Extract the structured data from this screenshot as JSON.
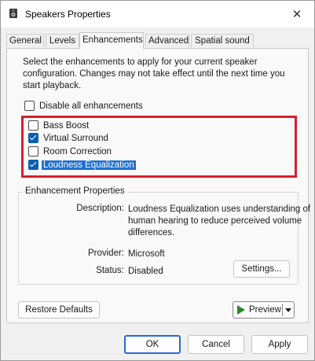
{
  "window": {
    "title": "Speakers Properties",
    "close_glyph": "✕"
  },
  "tabs": [
    {
      "label": "General"
    },
    {
      "label": "Levels"
    },
    {
      "label": "Enhancements",
      "active": true
    },
    {
      "label": "Advanced"
    },
    {
      "label": "Spatial sound"
    }
  ],
  "enhancements": {
    "intro": "Select the enhancements to apply for your current speaker configuration. Changes may not take effect until the next time you start playback.",
    "disable_all": {
      "label": "Disable all enhancements",
      "checked": false
    },
    "items": [
      {
        "label": "Bass Boost",
        "checked": false
      },
      {
        "label": "Virtual Surround",
        "checked": true
      },
      {
        "label": "Room Correction",
        "checked": false
      },
      {
        "label": "Loudness Equalization",
        "checked": true,
        "selected": true
      }
    ],
    "highlight_color": "#d8202a"
  },
  "properties": {
    "group_label": "Enhancement Properties",
    "description_label": "Description:",
    "description_lines": [
      "Loudness Equalization uses understanding of",
      "human hearing to reduce perceived volume",
      "differences."
    ],
    "provider_label": "Provider:",
    "provider_value": "Microsoft",
    "status_label": "Status:",
    "status_value": "Disabled",
    "settings_button": "Settings..."
  },
  "actions": {
    "restore_defaults": "Restore Defaults",
    "preview": "Preview"
  },
  "footer": {
    "ok": "OK",
    "cancel": "Cancel",
    "apply": "Apply"
  },
  "colors": {
    "accent": "#0a5fb0",
    "selection": "#1f6fd1",
    "preview_icon": "#2a8a2a"
  }
}
